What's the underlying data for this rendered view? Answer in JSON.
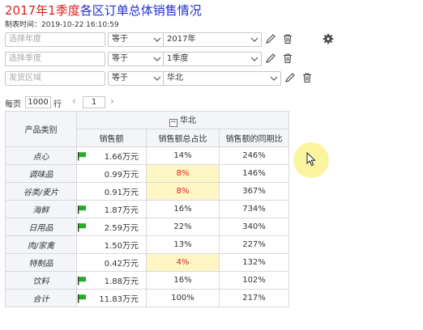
{
  "report": {
    "title_highlight": "2017年1季度",
    "title_rest": "各区订单总体销售情况",
    "created_label": "制表时间：",
    "created_time": "2019-10-22 16:10:59"
  },
  "filters": [
    {
      "field_placeholder": "选择年度",
      "operator": "等于",
      "value": "2017年"
    },
    {
      "field_placeholder": "选择季度",
      "operator": "等于",
      "value": "1季度"
    },
    {
      "field_placeholder": "发货区域",
      "operator": "等于",
      "value": "华北"
    }
  ],
  "pager": {
    "per_page_label": "每页",
    "page_size": "1000",
    "rows_label": "行",
    "prev_symbol": "‹",
    "current_page": "1",
    "next_symbol": "›"
  },
  "table": {
    "row_header": "产品类别",
    "group_header": "华北",
    "columns": [
      "销售额",
      "销售额总占比",
      "销售额的同期比"
    ],
    "rows": [
      {
        "category": "点心",
        "sales": "1.66万元",
        "flag": true,
        "ratio": "14%",
        "yoy": "246%",
        "highlight": false
      },
      {
        "category": "调味品",
        "sales": "0.99万元",
        "flag": false,
        "ratio": "8%",
        "yoy": "146%",
        "highlight": true
      },
      {
        "category": "谷类/麦片",
        "sales": "0.91万元",
        "flag": false,
        "ratio": "8%",
        "yoy": "367%",
        "highlight": true
      },
      {
        "category": "海鲜",
        "sales": "1.87万元",
        "flag": true,
        "ratio": "16%",
        "yoy": "734%",
        "highlight": false
      },
      {
        "category": "日用品",
        "sales": "2.59万元",
        "flag": true,
        "ratio": "22%",
        "yoy": "340%",
        "highlight": false
      },
      {
        "category": "肉/家禽",
        "sales": "1.50万元",
        "flag": false,
        "ratio": "13%",
        "yoy": "227%",
        "highlight": false
      },
      {
        "category": "特制品",
        "sales": "0.42万元",
        "flag": false,
        "ratio": "4%",
        "yoy": "132%",
        "highlight": true
      },
      {
        "category": "饮料",
        "sales": "1.88万元",
        "flag": true,
        "ratio": "16%",
        "yoy": "102%",
        "highlight": false
      },
      {
        "category": "合计",
        "sales": "11.83万元",
        "flag": true,
        "ratio": "100%",
        "yoy": "217%",
        "highlight": false
      }
    ]
  },
  "colors": {
    "title_red": "#e02020",
    "title_blue": "#2233cc",
    "flag_green": "#22b022",
    "highlight_bg": "#fff6c6",
    "highlight_text": "#e02020"
  }
}
